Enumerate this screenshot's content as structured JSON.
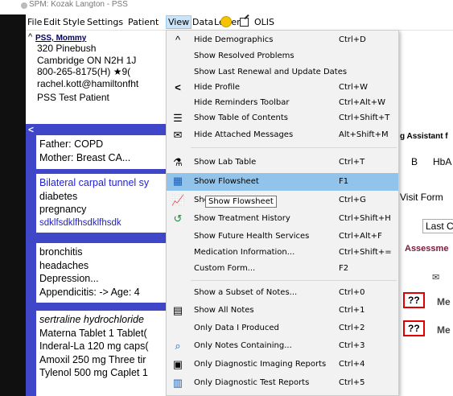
{
  "titlebar": {
    "text": "SPM: Kozak Langton - PSS"
  },
  "menubar": {
    "items": [
      "File",
      "Edit",
      "Style",
      "Settings",
      "Patient",
      "View",
      "Data",
      "Letter",
      "OLIS"
    ]
  },
  "patient": {
    "name": "PSS, Mommy",
    "address": "320 Pinebush",
    "city": "Cambridge ON  N2H 1J",
    "phone": "800-265-8175(H)  ★9(",
    "email": "rachel.kott@hamiltonfht",
    "status": "PSS Test Patient"
  },
  "family_history": [
    "Father: COPD",
    "Mother: Breast CA..."
  ],
  "problems": [
    "Bilateral carpal tunnel sy",
    "diabetes",
    "pregnancy",
    "sdklfsdklfhsdklfhsdk"
  ],
  "history": [
    "bronchitis",
    "headaches",
    "Depression...",
    "Appendicitis:  -> Age: 4"
  ],
  "medications": [
    "sertraline hydrochloride",
    "Materna Tablet 1 Tablet(",
    "Inderal-La 120 mg caps(",
    "Amoxil 250 mg Three tir",
    "Tylenol 500 mg Caplet 1"
  ],
  "right_panel": {
    "tab1": "g Assistant f",
    "col1": "B",
    "col2": "HbA",
    "tab2": "Visit Form",
    "tab3": "Last C",
    "assess": "Assessme",
    "q1": "??",
    "q1b": "Me",
    "q2": "??",
    "q2b": "Me"
  },
  "view_menu": [
    {
      "label": "Hide Demographics",
      "shortcut": "Ctrl+D",
      "icon": "caret-up-icon"
    },
    {
      "label": "Show Resolved Problems",
      "shortcut": "",
      "icon": ""
    },
    {
      "label": "Show Last Renewal and Update Dates",
      "shortcut": "",
      "icon": ""
    },
    {
      "label": "Hide Profile",
      "shortcut": "Ctrl+W",
      "icon": "caret-left-icon"
    },
    {
      "label": "Hide Reminders Toolbar",
      "shortcut": "Ctrl+Alt+W",
      "icon": ""
    },
    {
      "label": "Show Table of Contents",
      "shortcut": "Ctrl+Shift+T",
      "icon": "list-icon"
    },
    {
      "label": "Hide Attached Messages",
      "shortcut": "Alt+Shift+M",
      "icon": "message-icon"
    },
    {
      "label": "Show Lab Table",
      "shortcut": "Ctrl+T",
      "icon": "flask-icon"
    },
    {
      "label": "Show Flowsheet",
      "shortcut": "F1",
      "icon": "flowsheet-icon"
    },
    {
      "label": "Show Graph",
      "shortcut": "Ctrl+G",
      "icon": "graph-icon"
    },
    {
      "label": "Show Treatment History",
      "shortcut": "Ctrl+Shift+H",
      "icon": "history-icon"
    },
    {
      "label": "Show Future Health Services",
      "shortcut": "Ctrl+Alt+F",
      "icon": ""
    },
    {
      "label": "Medication Information...",
      "shortcut": "Ctrl+Shift+=",
      "icon": ""
    },
    {
      "label": "Custom Form...",
      "shortcut": "F2",
      "icon": ""
    },
    {
      "label": "Show a Subset of Notes...",
      "shortcut": "Ctrl+0",
      "icon": ""
    },
    {
      "label": "Show All Notes",
      "shortcut": "Ctrl+1",
      "icon": "notes-icon"
    },
    {
      "label": "Only Data I Produced",
      "shortcut": "Ctrl+2",
      "icon": ""
    },
    {
      "label": "Only Notes Containing...",
      "shortcut": "Ctrl+3",
      "icon": "search-notes-icon"
    },
    {
      "label": "Only Diagnostic Imaging Reports",
      "shortcut": "Ctrl+4",
      "icon": "imaging-icon"
    },
    {
      "label": "Only Diagnostic Test Reports",
      "shortcut": "Ctrl+5",
      "icon": "test-report-icon"
    }
  ],
  "tooltip": "Show Flowsheet",
  "colors": {
    "highlight": "#92c4eb",
    "profile_blue": "#3f46c8",
    "alert_red": "#e00000"
  }
}
